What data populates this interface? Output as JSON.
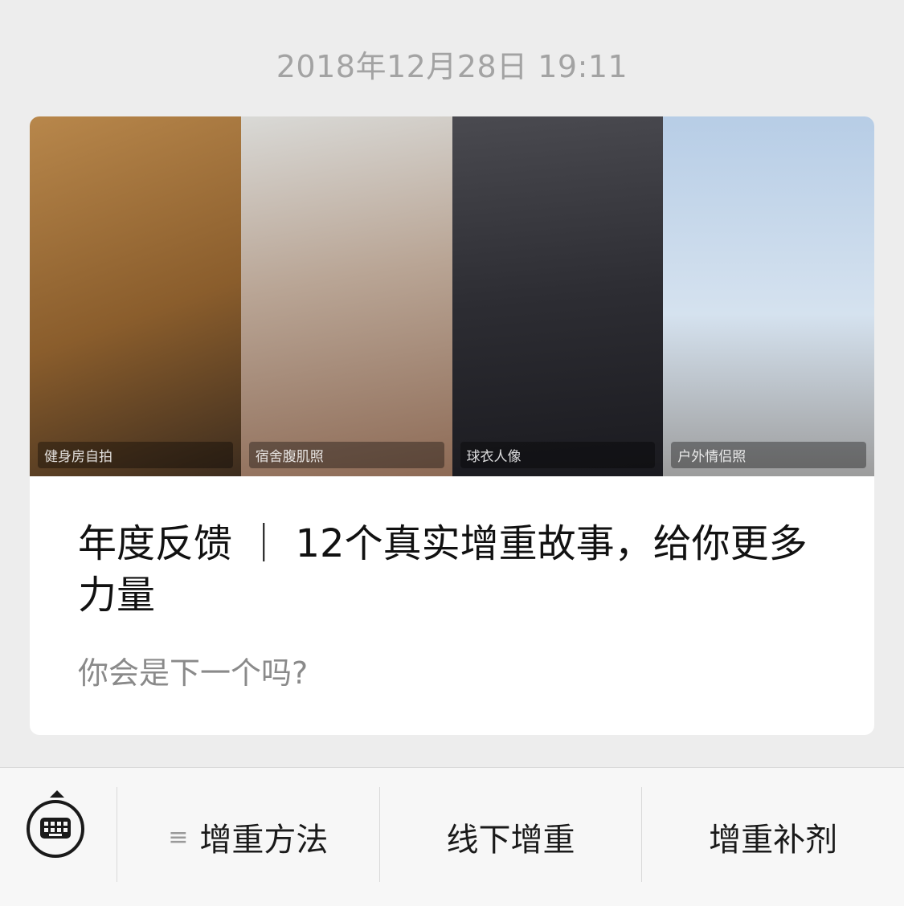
{
  "timestamp": "2018年12月28日 19:11",
  "article": {
    "title": "年度反馈 ｜ 12个真实增重故事，给你更多力量",
    "subtitle": "你会是下一个吗?",
    "photos": [
      {
        "label": "健身房自拍"
      },
      {
        "label": "宿舍腹肌照"
      },
      {
        "label": "球衣人像"
      },
      {
        "label": "户外情侣照"
      }
    ]
  },
  "bottom_menu": {
    "keyboard_icon": "keyboard-icon",
    "menu_glyph": "≡",
    "items": [
      {
        "label": "增重方法",
        "has_submenu": true
      },
      {
        "label": "线下增重"
      },
      {
        "label": "增重补剂"
      }
    ]
  },
  "colors": {
    "background": "#ededed",
    "card": "#ffffff",
    "timestamp": "#a3a3a3",
    "title": "#111111",
    "subtitle": "#8a8a8a"
  }
}
